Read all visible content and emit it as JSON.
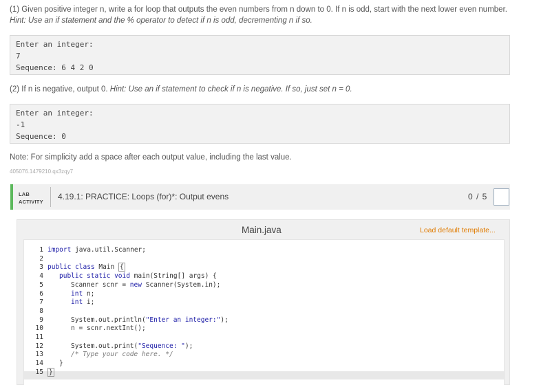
{
  "instructions": {
    "p1_text": "(1) Given positive integer n, write a for loop that outputs the even numbers from n down to 0. If n is odd, start with the next lower even number.",
    "p1_hint": "Hint: Use an if statement and the % operator to detect if n is odd, decrementing n if so.",
    "p2_text": "(2) If n is negative, output 0.",
    "p2_hint": "Hint: Use an if statement to check if n is negative. If so, just set n = 0.",
    "note": "Note: For simplicity add a space after each output value, including the last value.",
    "identifier": "405076.1479210.qx3zqy7"
  },
  "example1": {
    "prompt": "Enter an integer:",
    "input": "7",
    "output": "Sequence: 6 4 2 0"
  },
  "example2": {
    "prompt": "Enter an integer:",
    "input": "-1",
    "output": "Sequence: 0"
  },
  "lab": {
    "tag_line1": "LAB",
    "tag_line2": "ACTIVITY",
    "title": "4.19.1: PRACTICE: Loops (for)*: Output evens",
    "score": "0 / 5"
  },
  "editor": {
    "file_name": "Main.java",
    "load_template": "Load default template...",
    "line_numbers": [
      "1",
      "2",
      "3",
      "4",
      "5",
      "6",
      "7",
      "8",
      "9",
      "10",
      "11",
      "12",
      "13",
      "14",
      "15"
    ],
    "code": {
      "l1_kw": "import",
      "l1_rest": " java.util.Scanner;",
      "l3_kw": "public class",
      "l3_rest": " Main ",
      "l3_brace": "{",
      "l4_kw": "public static void",
      "l4_rest": " main(String[] args) {",
      "l5_a": "Scanner scnr = ",
      "l5_kw": "new",
      "l5_b": " Scanner(System.in);",
      "l6_kw": "int",
      "l6_rest": " n;",
      "l7_kw": "int",
      "l7_rest": " i;",
      "l9_a": "System.out.println(",
      "l9_str": "\"Enter an integer:\"",
      "l9_b": ");",
      "l10": "n = scnr.nextInt();",
      "l12_a": "System.out.print(",
      "l12_str": "\"Sequence: \"",
      "l12_b": ");",
      "l13_cm": "/* Type your code here. */",
      "l14": "}",
      "l15_brace": "}"
    }
  }
}
